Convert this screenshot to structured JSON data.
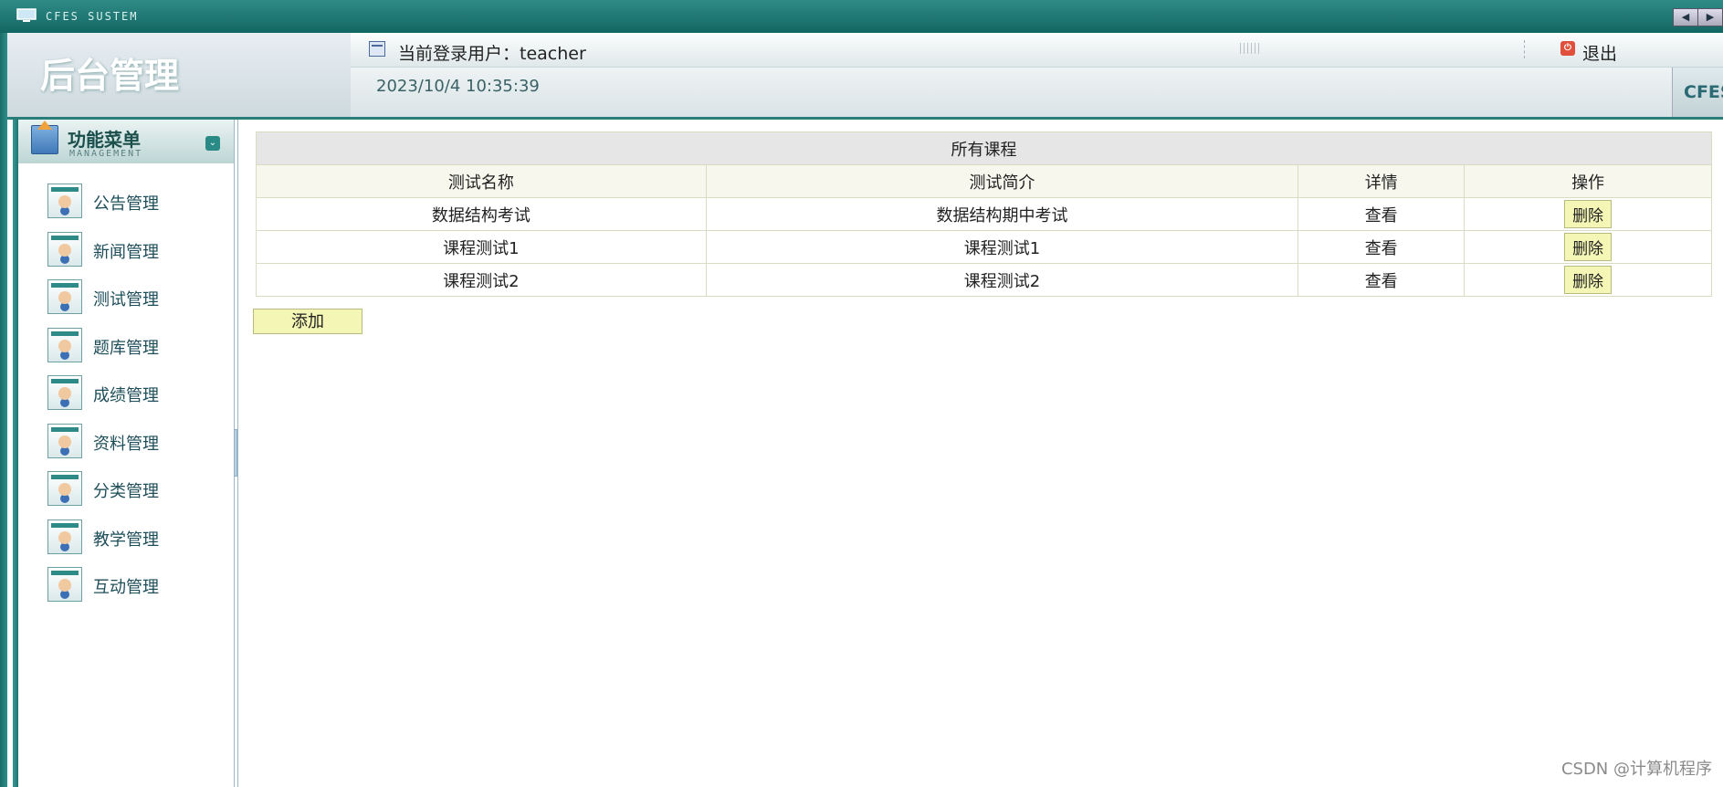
{
  "titlebar": {
    "system_name": "CFES SUSTEM"
  },
  "header": {
    "brand": "后台管理",
    "current_user_label": "当前登录用户：teacher",
    "logout_label": "退出",
    "datetime": "2023/10/4 10:35:39",
    "right_tag": "CFES"
  },
  "sidebar": {
    "title": "功能菜单",
    "subtitle": "MANAGEMENT",
    "items": [
      {
        "label": "公告管理"
      },
      {
        "label": "新闻管理"
      },
      {
        "label": "测试管理"
      },
      {
        "label": "题库管理"
      },
      {
        "label": "成绩管理"
      },
      {
        "label": "资料管理"
      },
      {
        "label": "分类管理"
      },
      {
        "label": "教学管理"
      },
      {
        "label": "互动管理"
      }
    ]
  },
  "main": {
    "table_caption": "所有课程",
    "columns": [
      "测试名称",
      "测试简介",
      "详情",
      "操作"
    ],
    "rows": [
      {
        "name": "数据结构考试",
        "intro": "数据结构期中考试",
        "detail": "查看",
        "action": "删除"
      },
      {
        "name": "课程测试1",
        "intro": "课程测试1",
        "detail": "查看",
        "action": "删除"
      },
      {
        "name": "课程测试2",
        "intro": "课程测试2",
        "detail": "查看",
        "action": "删除"
      }
    ],
    "add_label": "添加"
  },
  "watermark": "CSDN @计算机程序"
}
